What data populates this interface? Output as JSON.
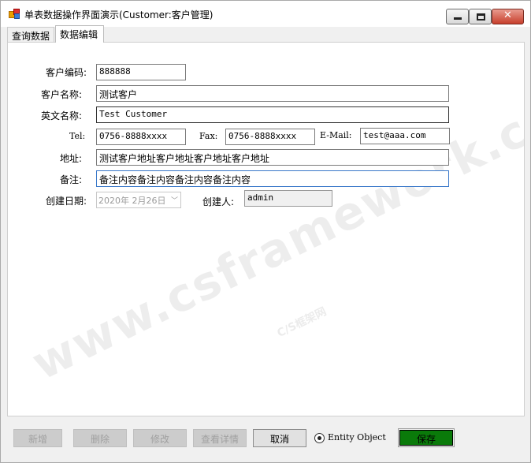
{
  "window": {
    "title": "单表数据操作界面演示(Customer:客户管理)",
    "minimize_glyph": "",
    "close_glyph": "✕"
  },
  "tabs": [
    {
      "label": "查询数据"
    },
    {
      "label": "数据编辑"
    }
  ],
  "form": {
    "customer_code": {
      "label": "客户编码:",
      "value": "888888"
    },
    "customer_name": {
      "label": "客户名称:",
      "value": "测试客户"
    },
    "english_name": {
      "label": "英文名称:",
      "value": "Test Customer"
    },
    "tel": {
      "label": "Tel:",
      "value": "0756-8888xxxx"
    },
    "fax": {
      "label": "Fax:",
      "value": "0756-8888xxxx"
    },
    "email": {
      "label": "E-Mail:",
      "value": "test@aaa.com"
    },
    "address": {
      "label": "地址:",
      "value": "测试客户地址客户地址客户地址客户地址"
    },
    "remark": {
      "label": "备注:",
      "value": "备注内容备注内容备注内容备注内容"
    },
    "create_date": {
      "label": "创建日期:",
      "value": "2020年 2月26日"
    },
    "creator": {
      "label": "创建人:",
      "value": "admin"
    }
  },
  "watermark": {
    "main": "www.csframework.com",
    "sub": "C/S框架网"
  },
  "buttons": {
    "add": "新增",
    "delete": "删除",
    "edit": "修改",
    "details": "查看详情",
    "cancel": "取消",
    "save": "保存"
  },
  "radio": {
    "label": "Entity Object",
    "selected": true
  },
  "colors": {
    "save_button": "#0a7a0a",
    "focus_border": "#3a78c9"
  }
}
